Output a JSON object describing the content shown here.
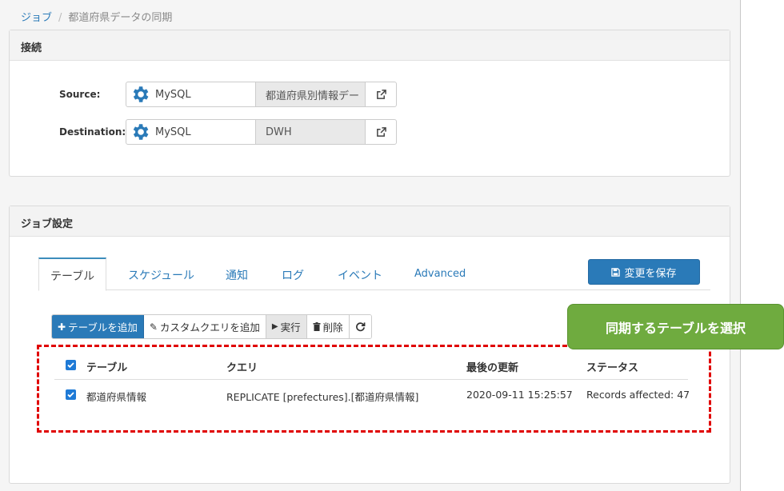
{
  "breadcrumb": {
    "root": "ジョブ",
    "current": "都道府県データの同期"
  },
  "connection": {
    "title": "接続",
    "source": {
      "label": "Source:",
      "type": "MySQL",
      "database": "都道府県別情報デー"
    },
    "destination": {
      "label": "Destination:",
      "type": "MySQL",
      "database": "DWH"
    }
  },
  "job_settings": {
    "title": "ジョブ設定",
    "tabs": [
      "テーブル",
      "スケジュール",
      "通知",
      "ログ",
      "イベント",
      "Advanced"
    ],
    "active_tab": "テーブル",
    "save_label": "変更を保存",
    "toolbar": {
      "add_table": "テーブルを追加",
      "add_custom_query": "カスタムクエリを追加",
      "run": "実行",
      "delete": "削除",
      "refresh_icon": "refresh-icon"
    },
    "table": {
      "headers": [
        "テーブル",
        "クエリ",
        "最後の更新",
        "ステータス"
      ],
      "rows": [
        {
          "table": "都道府県情報",
          "query": "REPLICATE [prefectures].[都道府県情報]",
          "updated": "2020-09-11 15:25:57",
          "status": "Records affected: 47",
          "checked": true
        }
      ]
    }
  },
  "callout": {
    "text": "同期するテーブルを選択",
    "color": "#6fab3f"
  },
  "colors": {
    "accent": "#2a7ab8",
    "highlight": "#e00000",
    "checkbox": "#1e7ad6"
  }
}
